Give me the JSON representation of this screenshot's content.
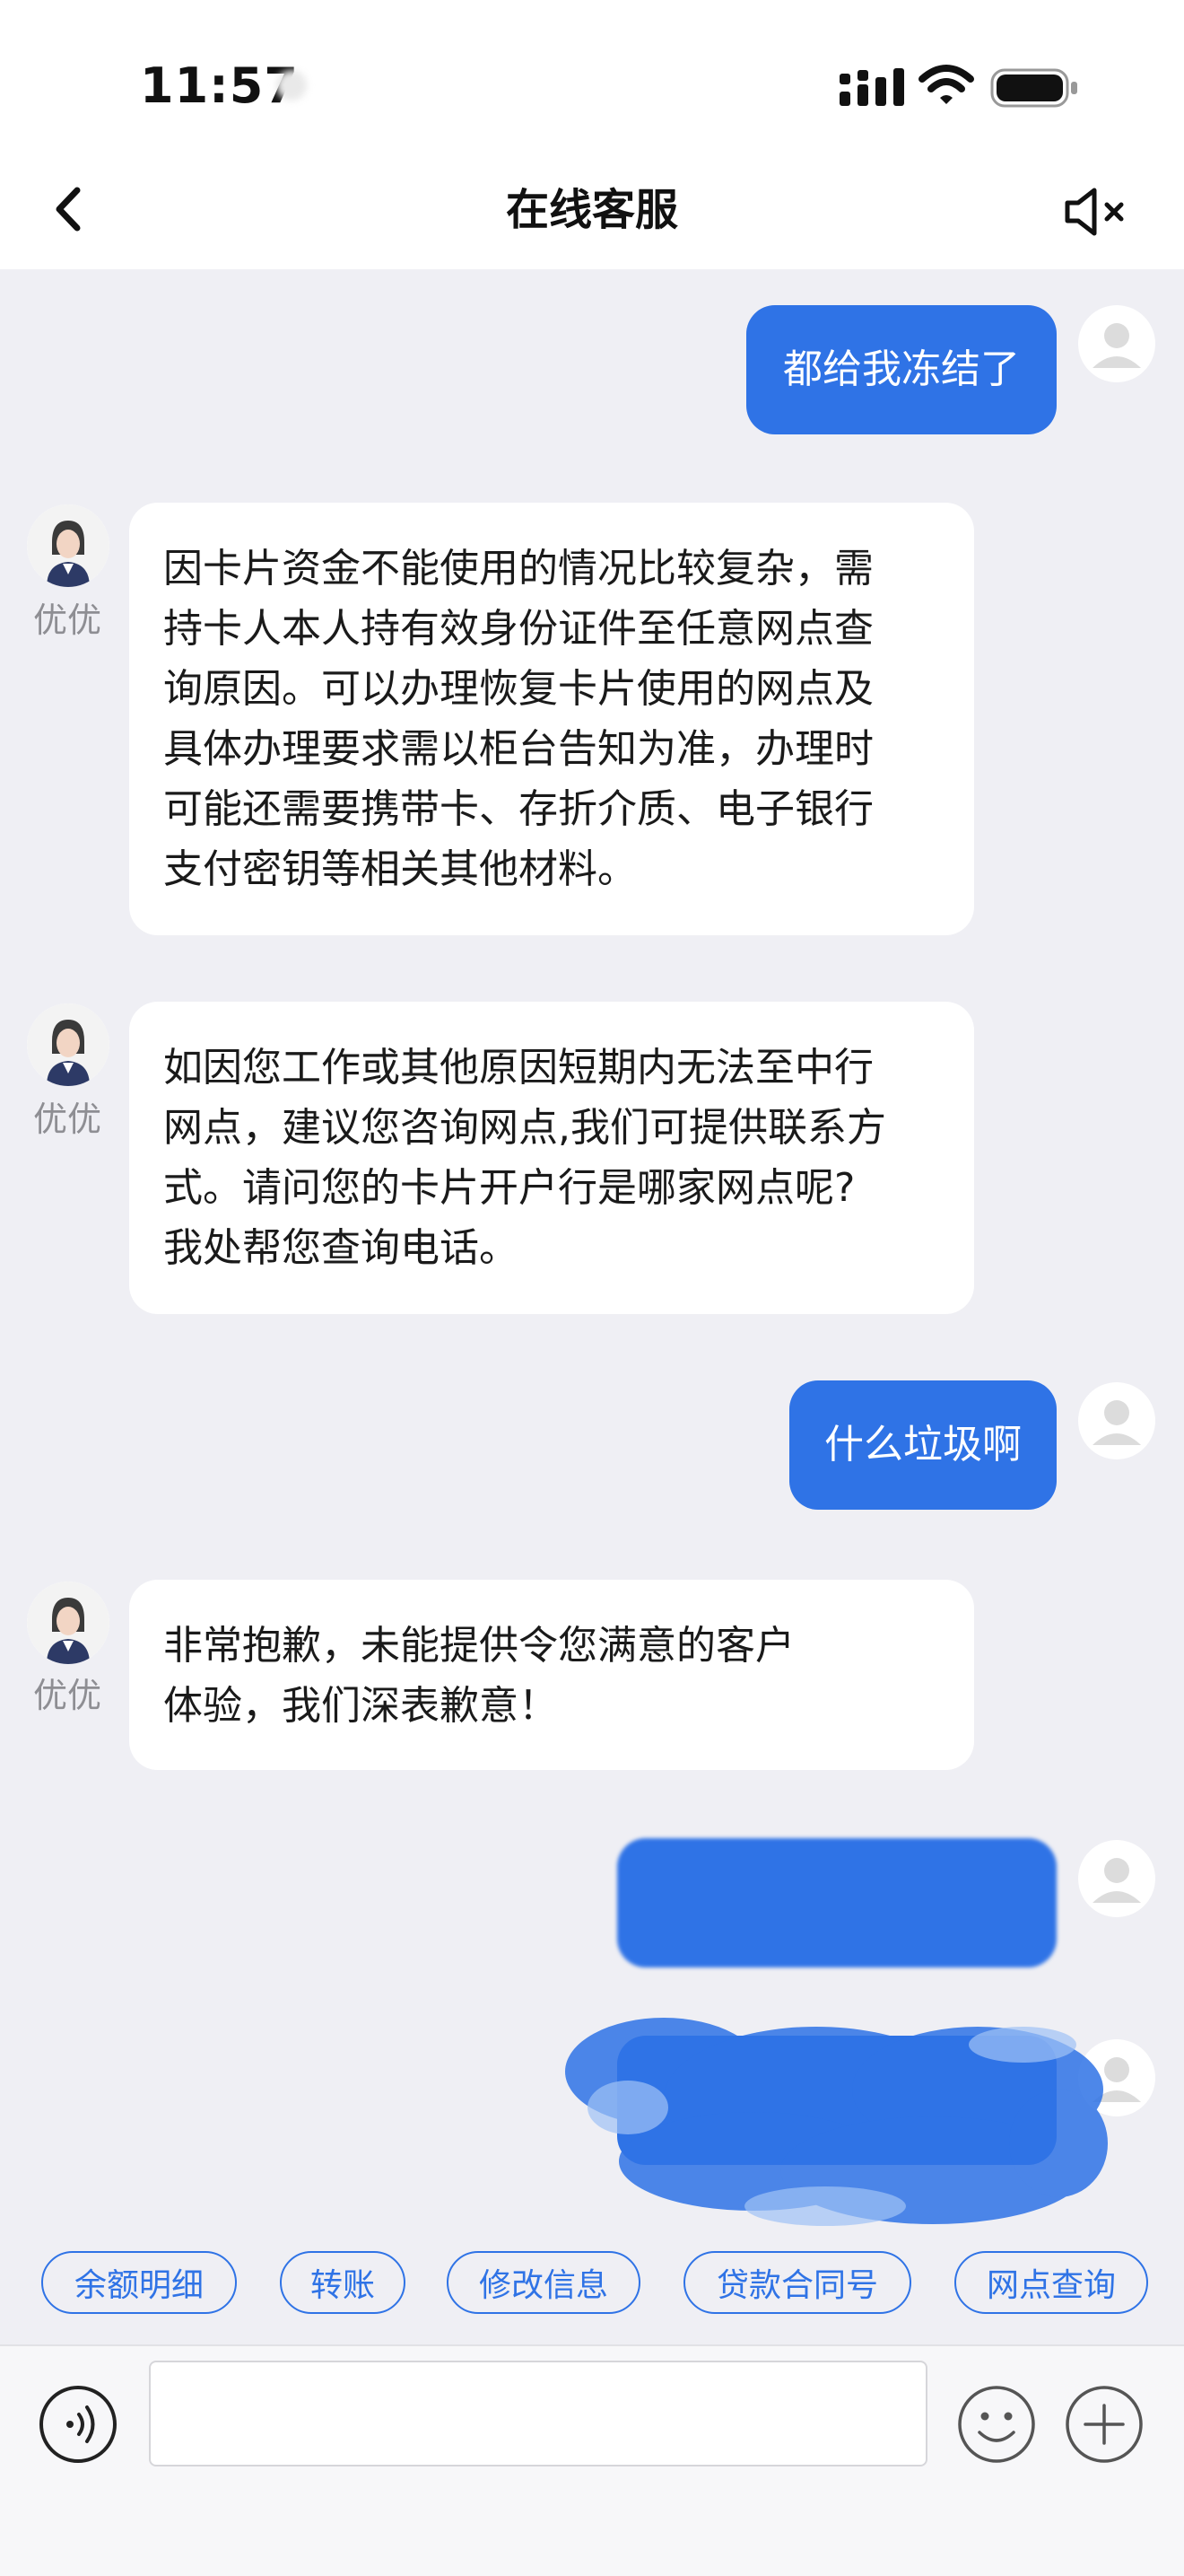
{
  "status_bar": {
    "time": "11:57"
  },
  "header": {
    "title": "在线客服",
    "back_icon": "chevron-left-icon",
    "mute_icon": "speaker-muted-icon"
  },
  "messages": [
    {
      "sender": "user",
      "text": "都给我冻结了"
    },
    {
      "sender": "bot",
      "name": "优优",
      "lines": [
        "因卡片资金不能使用的情况比较复杂，需",
        "持卡人本人持有效身份证件至任意网点查",
        "询原因。可以办理恢复卡片使用的网点及",
        "具体办理要求需以柜台告知为准，办理时",
        "可能还需要携带卡、存折介质、电子银行",
        "支付密钥等相关其他材料。"
      ]
    },
    {
      "sender": "bot",
      "name": "优优",
      "lines": [
        "如因您工作或其他原因短期内无法至中行",
        "网点，建议您咨询网点,我们可提供联系方",
        "式。请问您的卡片开户行是哪家网点呢?",
        "我处帮您查询电话。"
      ]
    },
    {
      "sender": "user",
      "text": "什么垃圾啊"
    },
    {
      "sender": "bot",
      "name": "优优",
      "lines": [
        "非常抱歉，未能提供令您满意的客户",
        "体验，我们深表歉意！"
      ]
    }
  ],
  "quick_actions": [
    "余额明细",
    "转账",
    "修改信息",
    "贷款合同号",
    "网点查询"
  ],
  "input_bar": {
    "voice_icon": "voice-icon",
    "emoji_icon": "smiley-icon",
    "plus_icon": "plus-icon"
  },
  "colors": {
    "accent": "#2f73e6",
    "background": "#efeff4",
    "bot_bubble": "#ffffff"
  }
}
